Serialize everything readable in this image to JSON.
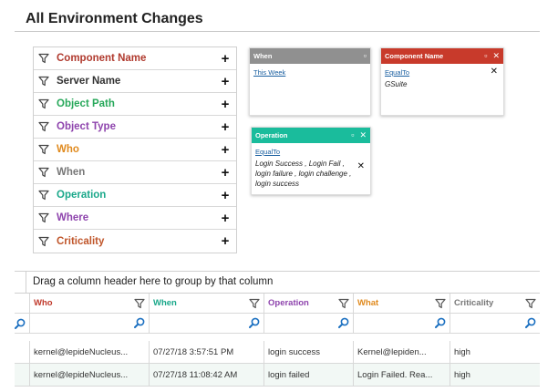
{
  "page": {
    "title": "All Environment Changes"
  },
  "colors": {
    "orange_red": "#c0392b",
    "dark": "#333333",
    "green": "#27a85a",
    "purple": "#8e44ad",
    "orange": "#e08a1e",
    "gray": "#777777",
    "teal": "#1abc9c",
    "dark_orange": "#c0562b"
  },
  "filters": [
    {
      "label": "Component Name",
      "color": "#b03a2e"
    },
    {
      "label": "Server Name",
      "color": "#333333"
    },
    {
      "label": "Object Path",
      "color": "#27a85a"
    },
    {
      "label": "Object Type",
      "color": "#8e44ad"
    },
    {
      "label": "Who",
      "color": "#e08a1e"
    },
    {
      "label": "When",
      "color": "#777777"
    },
    {
      "label": "Operation",
      "color": "#1aa88a"
    },
    {
      "label": "Where",
      "color": "#8e44ad"
    },
    {
      "label": "Criticality",
      "color": "#c0562b"
    }
  ],
  "cards": {
    "when": {
      "title": "When",
      "color": "#909090",
      "operator": "This Week",
      "value": ""
    },
    "component": {
      "title": "Component Name",
      "color": "#c83a2b",
      "operator": "EqualTo",
      "value": "GSuite"
    },
    "operation": {
      "title": "Operation",
      "color": "#1abc9c",
      "operator": "EqualTo",
      "value": "Login Success , Login Fail , login failure , login challenge , login success"
    }
  },
  "grid": {
    "group_hint": "Drag a column header here to group by that column",
    "columns": [
      {
        "label": "Who",
        "color": "#c0392b"
      },
      {
        "label": "When",
        "color": "#1aa88a"
      },
      {
        "label": "Operation",
        "color": "#8e44ad"
      },
      {
        "label": "What",
        "color": "#e08a1e"
      },
      {
        "label": "Criticality",
        "color": "#777777"
      }
    ],
    "rows": [
      [
        "kernel@lepideNucleus...",
        "07/27/18 3:57:51 PM",
        "login success",
        "Kernel@lepiden...",
        "high"
      ],
      [
        "kernel@lepideNucleus...",
        "07/27/18 11:08:42 AM",
        "login failed",
        "Login Failed. Rea...",
        "high"
      ]
    ]
  },
  "icons": {
    "filter": "funnel-icon",
    "add": "plus-icon",
    "search": "magnifier-icon",
    "minimize": "minimize-icon",
    "close": "close-icon"
  }
}
